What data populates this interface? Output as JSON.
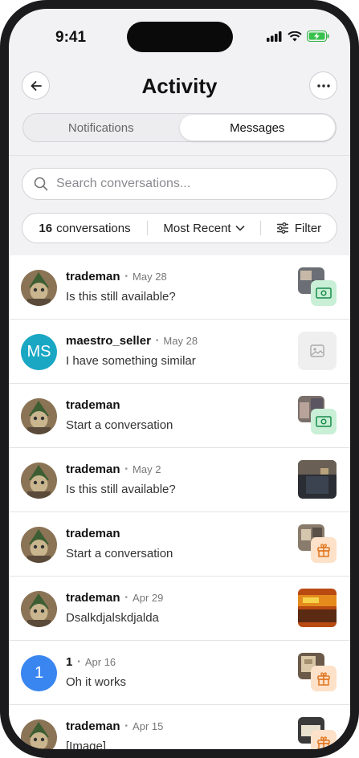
{
  "status_bar": {
    "time": "9:41"
  },
  "header": {
    "title": "Activity",
    "back_icon": "arrow-left-icon",
    "more_icon": "more-horizontal-icon"
  },
  "tabs": [
    {
      "label": "Notifications",
      "active": false
    },
    {
      "label": "Messages",
      "active": true
    }
  ],
  "search": {
    "placeholder": "Search conversations..."
  },
  "toolbar": {
    "count": "16",
    "count_label": "conversations",
    "sort_label": "Most Recent",
    "filter_label": "Filter"
  },
  "colors": {
    "green_badge": "#c9efd6",
    "orange_badge": "#fde1c8",
    "ms_avatar": "#1aa7c4",
    "one_avatar": "#3a86f0"
  },
  "conversations": [
    {
      "name": "trademan",
      "date": "May 28",
      "message": "Is this still available?",
      "avatar": "trademan-avatar",
      "badge": "cash-icon"
    },
    {
      "name": "maestro_seller",
      "date": "May 28",
      "message": "I have something similar",
      "avatar_initials": "MS",
      "thumb": "image-placeholder-icon"
    },
    {
      "name": "trademan",
      "date": "",
      "message": "Start a conversation",
      "avatar": "trademan-avatar",
      "badge": "cash-icon"
    },
    {
      "name": "trademan",
      "date": "May 2",
      "message": "Is this still available?",
      "avatar": "trademan-avatar",
      "thumb": "photo"
    },
    {
      "name": "trademan",
      "date": "",
      "message": "Start a conversation",
      "avatar": "trademan-avatar",
      "badge": "gift-icon"
    },
    {
      "name": "trademan",
      "date": "Apr 29",
      "message": "Dsalkdjalskdjalda",
      "avatar": "trademan-avatar",
      "thumb": "photo"
    },
    {
      "name": "1",
      "date": "Apr 16",
      "message": "Oh it works",
      "avatar_initials": "1",
      "badge": "gift-icon"
    },
    {
      "name": "trademan",
      "date": "Apr 15",
      "message": "[Image]",
      "avatar": "trademan-avatar",
      "badge": "gift-icon"
    }
  ]
}
